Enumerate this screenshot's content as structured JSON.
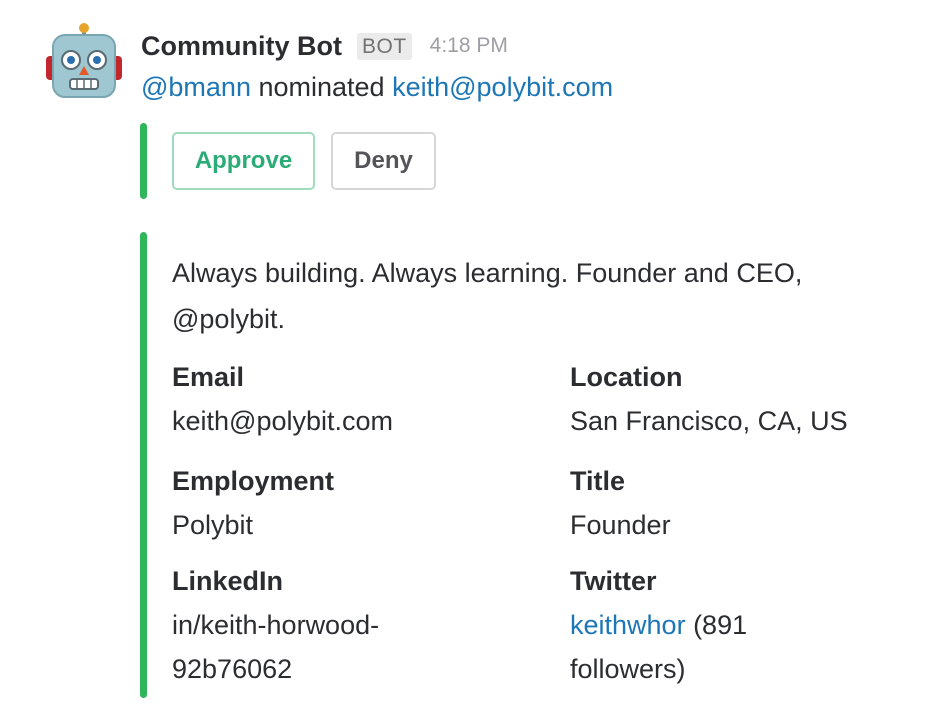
{
  "message": {
    "bot_name": "Community Bot",
    "bot_badge": "BOT",
    "timestamp": "4:18 PM",
    "mention": "@bmann",
    "action_text": "nominated",
    "nominee_email": "keith@polybit.com",
    "avatar_icon": "robot-face-icon"
  },
  "actions": {
    "approve_label": "Approve",
    "deny_label": "Deny"
  },
  "profile": {
    "bio_line1": "Always building. Always learning. Founder and CEO,",
    "bio_line2": "@polybit.",
    "fields": {
      "email": {
        "title": "Email",
        "value": "keith@polybit.com"
      },
      "location": {
        "title": "Location",
        "value": "San Francisco, CA, US"
      },
      "employment": {
        "title": "Employment",
        "value": "Polybit"
      },
      "title": {
        "title": "Title",
        "value": "Founder"
      },
      "linkedin": {
        "title": "LinkedIn",
        "value_line1": "in/keith-horwood-",
        "value_line2": "92b76062"
      },
      "twitter": {
        "title": "Twitter",
        "handle": "keithwhor",
        "followers_line1": " (891",
        "followers_line2": "followers)"
      }
    }
  },
  "colors": {
    "accent_bar": "#2fb65a",
    "link": "#1d76b5",
    "approve": "#2bac76"
  }
}
